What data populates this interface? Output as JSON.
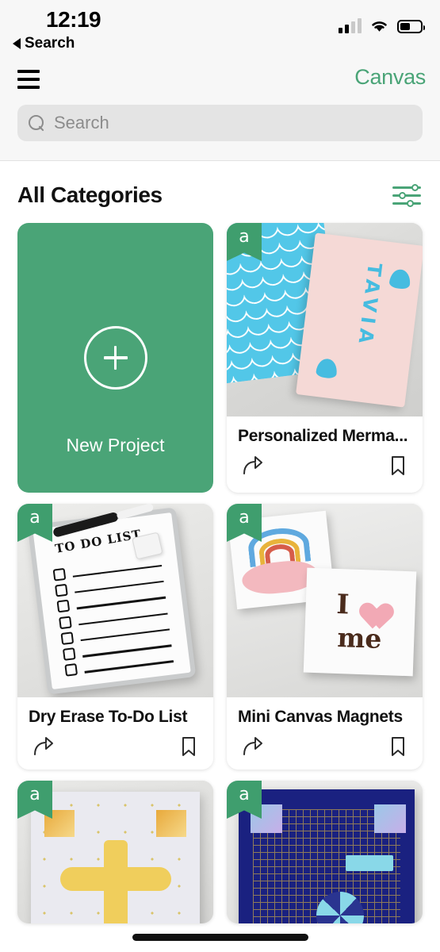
{
  "status_bar": {
    "time": "12:19",
    "back_label": "Search",
    "signal_bars_filled": 2,
    "signal_bars_total": 4,
    "wifi": "wifi-icon",
    "battery_percent": 52
  },
  "nav": {
    "menu_icon": "hamburger-menu-icon",
    "brand": "Canvas"
  },
  "search": {
    "placeholder": "Search",
    "value": "",
    "icon": "search-icon"
  },
  "section": {
    "title": "All Categories",
    "filter_icon": "filter-sliders-icon"
  },
  "new_project": {
    "label": "New Project",
    "icon": "plus-circle-icon"
  },
  "colors": {
    "brand_green": "#4AA477",
    "badge_green": "#3F9E6E",
    "header_bg": "#F7F7F7",
    "search_bg": "#E4E4E4",
    "text_primary": "#111111",
    "placeholder": "#8C8C8C"
  },
  "badge": {
    "logo": "a",
    "name": "app-logo-badge"
  },
  "card_actions": {
    "share": "share-icon",
    "bookmark": "bookmark-icon"
  },
  "products": [
    {
      "title": "Personalized Merma...",
      "art": "mermaid-journal",
      "monogram": "TAVIA"
    },
    {
      "title": "Dry Erase To-Do List",
      "art": "dry-erase-board",
      "board_heading": "TO DO LIST"
    },
    {
      "title": "Mini Canvas Magnets",
      "art": "canvas-magnets",
      "magnet_text_i": "I",
      "magnet_text_me": "me"
    }
  ],
  "products_partial": [
    {
      "art": "gold-cross-card"
    },
    {
      "art": "navy-mesh-card"
    }
  ]
}
